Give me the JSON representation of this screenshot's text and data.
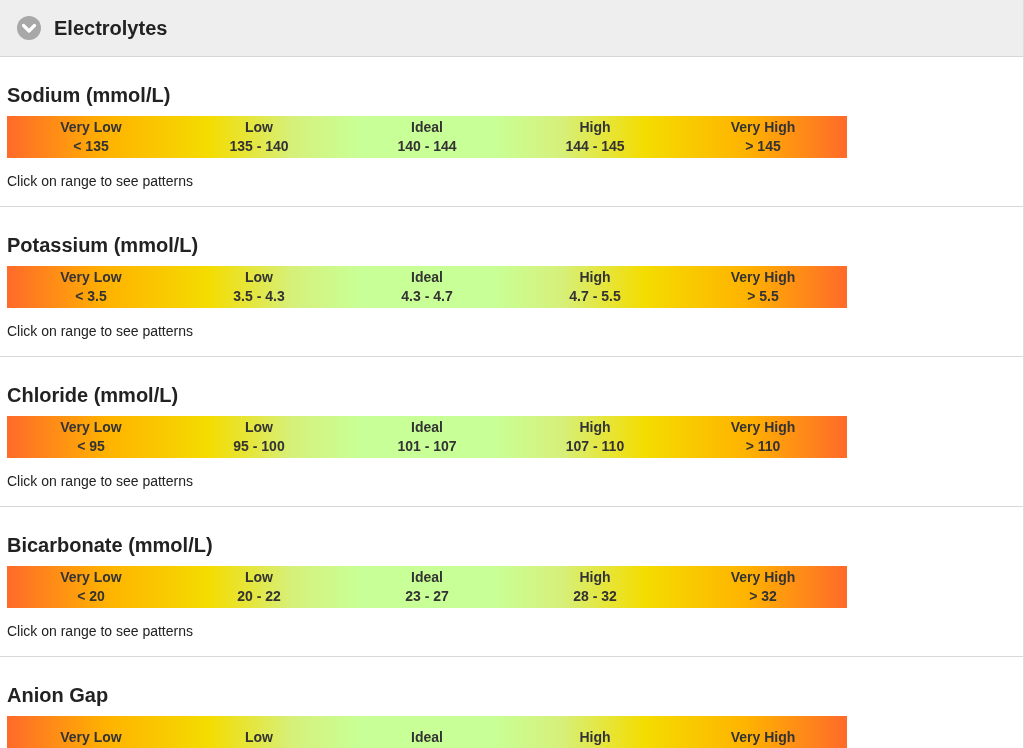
{
  "header": {
    "title": "Electrolytes",
    "expanded": true
  },
  "tests": [
    {
      "name": "Sodium (mmol/L)",
      "ranges": [
        {
          "label": "Very Low",
          "value": "< 135"
        },
        {
          "label": "Low",
          "value": "135 - 140"
        },
        {
          "label": "Ideal",
          "value": "140 - 144"
        },
        {
          "label": "High",
          "value": "144 - 145"
        },
        {
          "label": "Very High",
          "value": "> 145"
        }
      ],
      "hint": "Click on range to see patterns"
    },
    {
      "name": "Potassium (mmol/L)",
      "ranges": [
        {
          "label": "Very Low",
          "value": "< 3.5"
        },
        {
          "label": "Low",
          "value": "3.5 - 4.3"
        },
        {
          "label": "Ideal",
          "value": "4.3 - 4.7"
        },
        {
          "label": "High",
          "value": "4.7 - 5.5"
        },
        {
          "label": "Very High",
          "value": "> 5.5"
        }
      ],
      "hint": "Click on range to see patterns"
    },
    {
      "name": "Chloride (mmol/L)",
      "ranges": [
        {
          "label": "Very Low",
          "value": "< 95"
        },
        {
          "label": "Low",
          "value": "95 - 100"
        },
        {
          "label": "Ideal",
          "value": "101 - 107"
        },
        {
          "label": "High",
          "value": "107 - 110"
        },
        {
          "label": "Very High",
          "value": "> 110"
        }
      ],
      "hint": "Click on range to see patterns"
    },
    {
      "name": "Bicarbonate (mmol/L)",
      "ranges": [
        {
          "label": "Very Low",
          "value": "< 20"
        },
        {
          "label": "Low",
          "value": "20 - 22"
        },
        {
          "label": "Ideal",
          "value": "23 - 27"
        },
        {
          "label": "High",
          "value": "28 - 32"
        },
        {
          "label": "Very High",
          "value": "> 32"
        }
      ],
      "hint": "Click on range to see patterns"
    },
    {
      "name": "Anion Gap",
      "ranges": [
        {
          "label": "Very Low"
        },
        {
          "label": "Low"
        },
        {
          "label": "Ideal"
        },
        {
          "label": "High"
        },
        {
          "label": "Very High"
        }
      ]
    }
  ]
}
